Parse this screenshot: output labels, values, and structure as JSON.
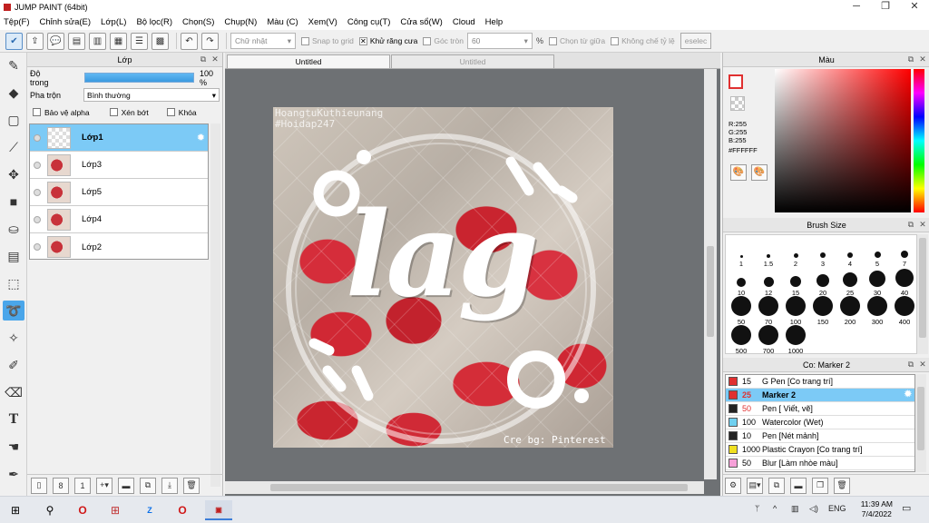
{
  "window": {
    "title": "JUMP PAINT (64bit)",
    "controls": [
      "─",
      "❐",
      "✕"
    ]
  },
  "menu": [
    "Tệp(F)",
    "Chỉnh sửa(E)",
    "Lớp(L)",
    "Bộ lọc(R)",
    "Chọn(S)",
    "Chụp(N)",
    "Màu (C)",
    "Xem(V)",
    "Công cụ(T)",
    "Cửa sổ(W)",
    "Cloud",
    "Help"
  ],
  "toolbar": {
    "shape_select": "Chữ nhật",
    "snap_label": "Snap to grid",
    "antialias_label": "Khử răng cưa",
    "round_label": "Góc tròn",
    "round_value": "60",
    "percent": "%",
    "center_label": "Chọn từ giữa",
    "ratio_label": "Không chế tỷ lệ",
    "deselect_label": "eselec"
  },
  "layer_panel": {
    "title": "Lớp",
    "opacity_label": "Độ trong",
    "opacity_value": "100 %",
    "opacity_fraction": 1.0,
    "blend_label": "Pha trộn",
    "blend_value": "Bình thường",
    "opt_alpha": "Bảo vệ alpha",
    "opt_clip": "Xén bớt",
    "opt_lock": "Khóa",
    "layers": [
      {
        "name": "Lớp1",
        "selected": true
      },
      {
        "name": "Lớp3",
        "selected": false
      },
      {
        "name": "Lớp5",
        "selected": false
      },
      {
        "name": "Lớp4",
        "selected": false
      },
      {
        "name": "Lớp2",
        "selected": false
      }
    ]
  },
  "canvas": {
    "tab_active": "Untitled",
    "tab_inactive": "Untitled",
    "watermark_top1": "HoangtuKuthieunang",
    "watermark_top2": "#Hoidap247",
    "watermark_bottom": "Cre bg: Pinterest",
    "art_text": "lag"
  },
  "color_panel": {
    "title": "Màu",
    "r": "R:255",
    "g": "G:255",
    "b": "B:255",
    "hex": "#FFFFFF",
    "accent": "#e03030"
  },
  "brush_panel": {
    "title": "Brush Size",
    "sizes": [
      "1",
      "1.5",
      "2",
      "3",
      "4",
      "5",
      "7",
      "10",
      "12",
      "15",
      "20",
      "25",
      "30",
      "40",
      "50",
      "70",
      "100",
      "150",
      "200",
      "300",
      "400",
      "500",
      "700",
      "1000"
    ]
  },
  "tool_panel": {
    "title": "Co: Marker 2",
    "items": [
      {
        "size": "15",
        "name": "G Pen [Co trang trí]",
        "color": "#e03030",
        "selected": false,
        "red": false
      },
      {
        "size": "25",
        "name": "Marker 2",
        "color": "#e03030",
        "selected": true,
        "red": true
      },
      {
        "size": "50",
        "name": "Pen [ Viết, vẽ]",
        "color": "#222222",
        "selected": false,
        "red": true
      },
      {
        "size": "100",
        "name": "Watercolor (Wet)",
        "color": "#6fd0f0",
        "selected": false,
        "red": false
      },
      {
        "size": "10",
        "name": "Pen [Nét mảnh]",
        "color": "#222222",
        "selected": false,
        "red": false
      },
      {
        "size": "1000",
        "name": "Plastic Crayon [Co trang trí]",
        "color": "#f0e020",
        "selected": false,
        "red": false
      },
      {
        "size": "50",
        "name": "Blur [Làm nhòe màu]",
        "color": "#f6a0d8",
        "selected": false,
        "red": false
      }
    ]
  },
  "taskbar": {
    "ime": "ENG",
    "time": "11:39 AM",
    "date": "7/4/2022"
  }
}
